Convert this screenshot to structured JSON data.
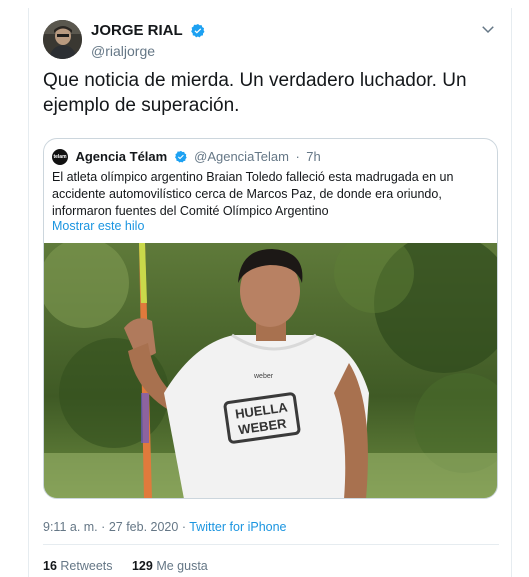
{
  "tweet": {
    "author": {
      "name": "JORGE RIAL",
      "handle": "@rialjorge",
      "avatar_icon": "avatar-photo",
      "verified": true
    },
    "text": "Que noticia de mierda. Un verdadero luchador. Un ejemplo de superación.",
    "menu_icon": "chevron-down-icon"
  },
  "quote": {
    "logo_text": "telam",
    "name": "Agencia Télam",
    "handle": "@AgenciaTelam",
    "dot": "·",
    "time": "7h",
    "text": "El atleta olímpico argentino Braian Toledo falleció esta madrugada en un accidente automovilístico cerca de Marcos Paz, de donde era oriundo, informaron fuentes del Comité Olímpico Argentino",
    "thread_link": "Mostrar este hilo",
    "photo_shirt_line1": "HUELLA",
    "photo_shirt_line2": "WEBER",
    "photo_shirt_brand": "weber"
  },
  "meta": {
    "time": "9:11 a. m.",
    "sep1": "·",
    "date": "27 feb. 2020",
    "sep2": "·",
    "source": "Twitter for iPhone"
  },
  "stats": {
    "retweets_count": "16",
    "retweets_label": "Retweets",
    "likes_count": "129",
    "likes_label": "Me gusta"
  },
  "colors": {
    "link": "#1b95e0",
    "verified": "#1da1f2",
    "muted": "#657786",
    "border": "#e6ecf0"
  }
}
